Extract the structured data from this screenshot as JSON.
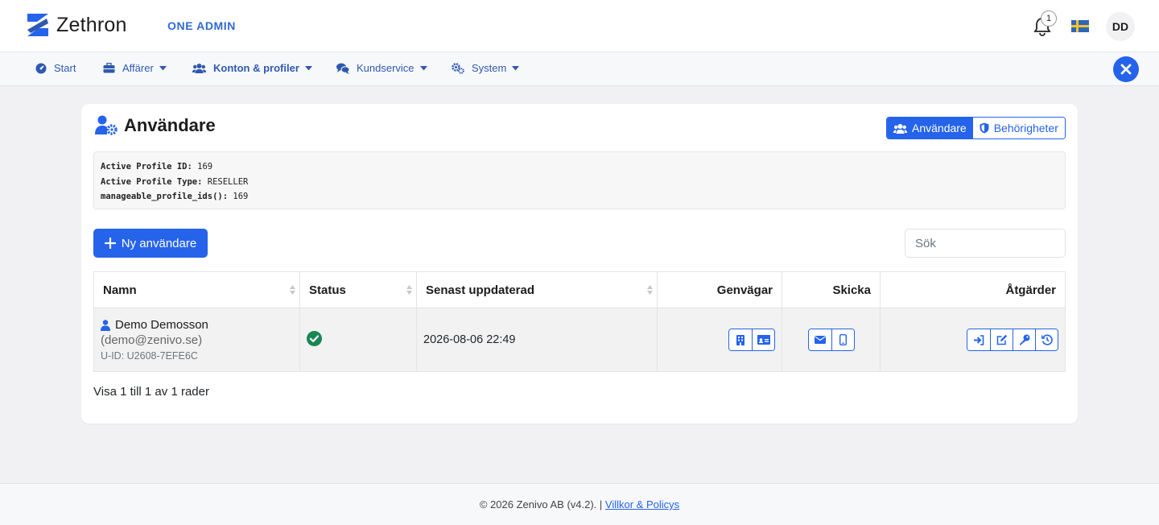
{
  "brand": {
    "name": "Zethron",
    "admin_title": "ONE ADMIN"
  },
  "header": {
    "notification_count": "1",
    "avatar_initials": "DD",
    "flag": "sweden-flag"
  },
  "nav": {
    "items": [
      {
        "label": "Start",
        "icon": "dashboard-icon",
        "dropdown": false
      },
      {
        "label": "Affärer",
        "icon": "briefcase-icon",
        "dropdown": true
      },
      {
        "label": "Konton & profiler",
        "icon": "users-icon",
        "dropdown": true,
        "active": true
      },
      {
        "label": "Kundservice",
        "icon": "chat-icon",
        "dropdown": true
      },
      {
        "label": "System",
        "icon": "gears-icon",
        "dropdown": true
      }
    ]
  },
  "page": {
    "title": "Användare",
    "tabs": [
      {
        "label": "Användare",
        "active": true
      },
      {
        "label": "Behörigheter",
        "active": false
      }
    ]
  },
  "debug": [
    {
      "key": "Active Profile ID:",
      "value": " 169"
    },
    {
      "key": "Active Profile Type:",
      "value": " RESELLER"
    },
    {
      "key": "manageable_profile_ids():",
      "value": " 169"
    }
  ],
  "toolbar": {
    "new_user_label": "Ny användare",
    "search_placeholder": "Sök"
  },
  "table": {
    "columns": [
      "Namn",
      "Status",
      "Senast uppdaterad",
      "Genvägar",
      "Skicka",
      "Åtgärder"
    ],
    "rows": [
      {
        "name": "Demo Demosson",
        "email": "(demo@zenivo.se)",
        "uid": "U-ID: U2608-7EFE6C",
        "status": "active",
        "updated": "2026-08-06 22:49",
        "shortcuts": [
          "building-icon",
          "id-card-icon"
        ],
        "send": [
          "envelope-icon",
          "mobile-icon"
        ],
        "actions": [
          "login-icon",
          "edit-icon",
          "key-icon",
          "history-icon"
        ]
      }
    ],
    "summary": "Visa 1 till 1 av 1 rader"
  },
  "footer": {
    "copyright": "© 2026 Zenivo AB (v4.2). | ",
    "link": "Villkor & Policys"
  },
  "colors": {
    "primary": "#2563eb",
    "success": "#198754",
    "background": "#f1f1f4"
  }
}
